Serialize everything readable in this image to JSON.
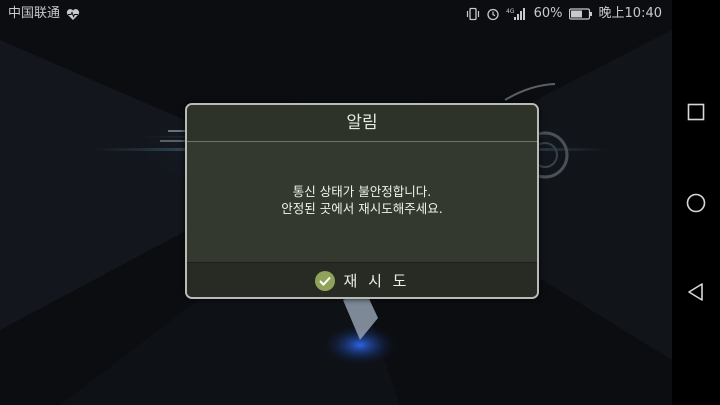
{
  "status_bar": {
    "carrier": "中国联通",
    "battery_percent": "60%",
    "time": "晚上10:40",
    "network": "4G",
    "icons": [
      "heart-pulse-icon",
      "vibrate-icon",
      "alarm-icon",
      "signal-icon",
      "battery-icon"
    ]
  },
  "dialog": {
    "title": "알림",
    "message_line1": "통신 상태가 불안정합니다.",
    "message_line2": "안정된 곳에서 재시도해주세요.",
    "retry_label": "재 시 도"
  },
  "nav_bar": {
    "buttons": [
      "recents",
      "home",
      "back"
    ]
  },
  "colors": {
    "dialog_bg": "#34392f",
    "dialog_border": "#b9bcb4",
    "check_icon": "#8fa35a"
  }
}
